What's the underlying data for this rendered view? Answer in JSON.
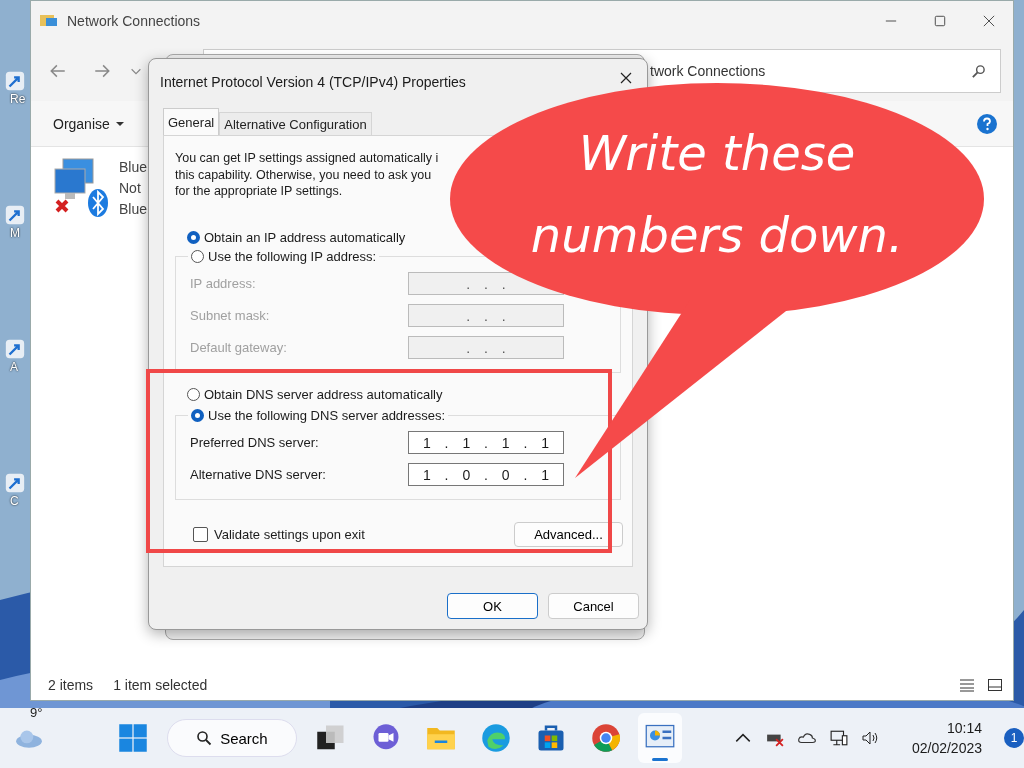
{
  "desktop": {
    "icons": [
      {
        "label": "Re"
      },
      {
        "label": "M"
      },
      {
        "label": "A"
      },
      {
        "label": "C"
      }
    ]
  },
  "explorer": {
    "title": "Network Connections",
    "address": "twork Connections",
    "organise": "Organise",
    "items": [
      {
        "lines": [
          "Blue",
          "Not",
          "Blue"
        ]
      }
    ],
    "status": [
      "2 items",
      "1 item selected"
    ]
  },
  "dialog": {
    "title": "Internet Protocol Version 4 (TCP/IPv4) Properties",
    "tabs": [
      {
        "label": "General",
        "selected": true
      },
      {
        "label": "Alternative Configuration",
        "selected": false
      }
    ],
    "intro": [
      "You can get IP settings assigned automatically i",
      "this capability. Otherwise, you need to ask you",
      "for the appropriate IP settings."
    ],
    "ip_modes": [
      {
        "label": "Obtain an IP address automatically",
        "selected": true
      },
      {
        "label": "Use the following IP address:",
        "selected": false
      }
    ],
    "ip_fields": [
      {
        "label": "IP address:",
        "value": ". . .",
        "disabled": true
      },
      {
        "label": "Subnet mask:",
        "value": ". . .",
        "disabled": true
      },
      {
        "label": "Default gateway:",
        "value": ". . .",
        "disabled": true
      }
    ],
    "dns_modes": [
      {
        "label": "Obtain DNS server address automatically",
        "selected": false
      },
      {
        "label": "Use the following DNS server addresses:",
        "selected": true
      }
    ],
    "dns_fields": [
      {
        "label": "Preferred DNS server:",
        "value": "1 . 1 . 1 . 1",
        "disabled": false
      },
      {
        "label": "Alternative DNS server:",
        "value": "1 . 0 . 0 . 1",
        "disabled": false
      }
    ],
    "validate": {
      "label": "Validate settings upon exit",
      "checked": false
    },
    "advanced": "Advanced...",
    "buttons": [
      "OK",
      "Cancel"
    ]
  },
  "callout": {
    "text": "Write these numbers down."
  },
  "taskbar": {
    "weather": "9°",
    "search": "Search",
    "time": "10:14",
    "date": "02/02/2023",
    "badge": "1"
  }
}
